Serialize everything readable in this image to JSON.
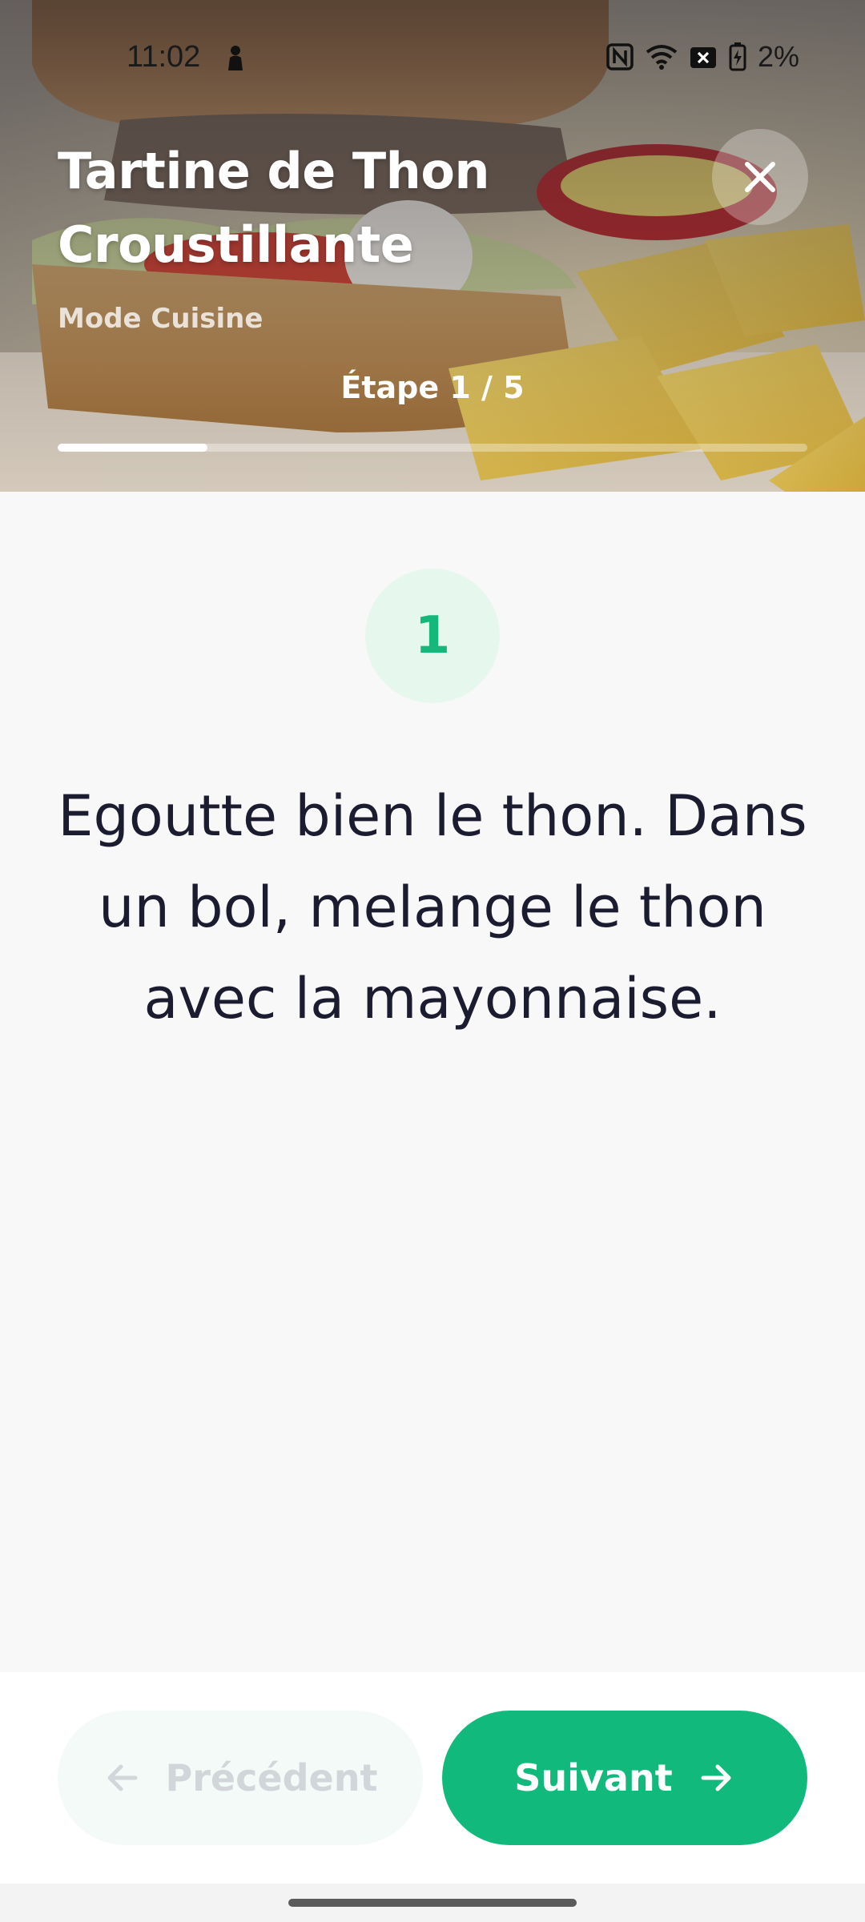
{
  "status_bar": {
    "time": "11:02",
    "battery_text": "2%",
    "icons": [
      "person-icon",
      "nfc-icon",
      "wifi-icon",
      "no-sim-icon",
      "battery-charging-icon"
    ]
  },
  "header": {
    "title": "Tartine de Thon Croustillante",
    "subtitle": "Mode Cuisine",
    "step_label": "Étape 1 / 5",
    "current_step": 1,
    "total_steps": 5,
    "close_icon": "close-icon"
  },
  "step": {
    "number": "1",
    "instruction": "Egoutte bien le thon. Dans un bol, melange le thon avec la mayonnaise."
  },
  "navigation": {
    "previous_label": "Précédent",
    "previous_enabled": false,
    "previous_icon": "arrow-left-icon",
    "next_label": "Suivant",
    "next_icon": "arrow-right-icon"
  },
  "colors": {
    "accent": "#12b97d",
    "step_circle_bg": "#e6f8ee",
    "text": "#1c1c30"
  }
}
